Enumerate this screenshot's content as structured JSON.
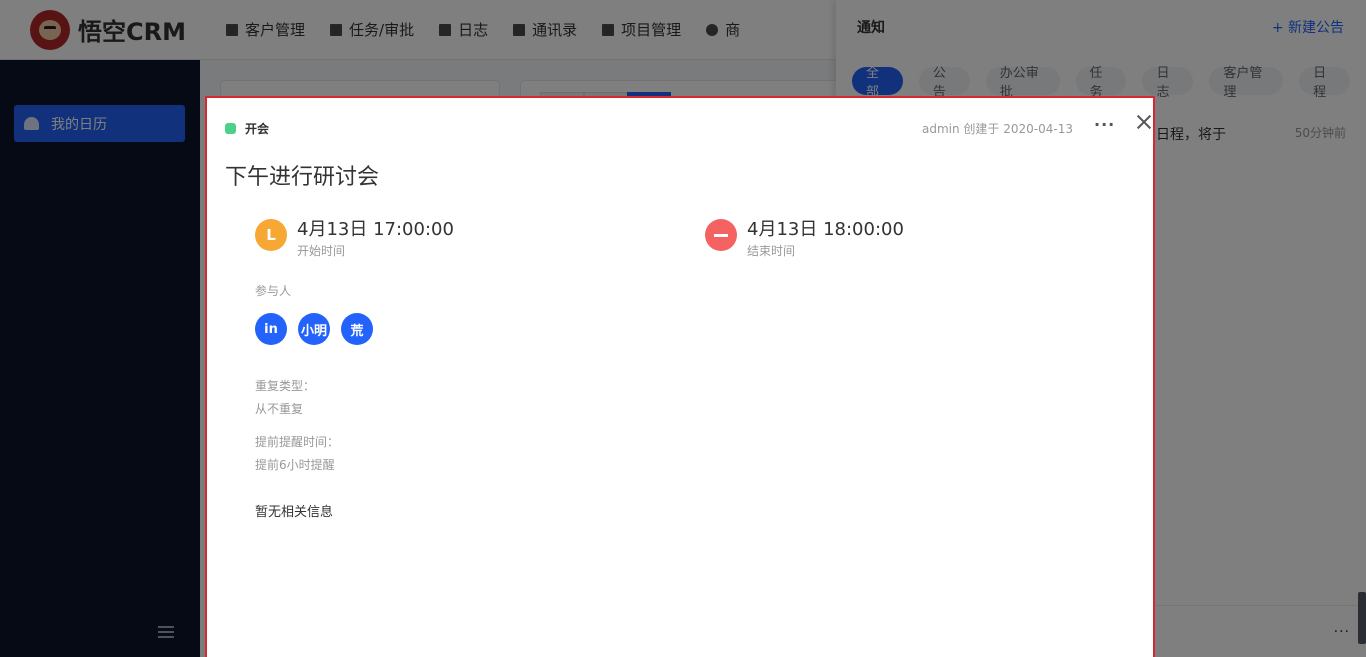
{
  "app": {
    "logo_text": "悟空CRM"
  },
  "nav": [
    "客户管理",
    "任务/审批",
    "日志",
    "通讯录",
    "项目管理",
    "商"
  ],
  "sidebar": {
    "active_item": "我的日历"
  },
  "notice_panel": {
    "title": "通知",
    "new_button": "+ 新建公告",
    "tabs": [
      "全部",
      "公告",
      "办公审批",
      "任务",
      "日志",
      "客户管理",
      "日程"
    ],
    "active_tab": 0,
    "item_text": "日程，将于",
    "item_time": "50分钟前",
    "footer_more": "···"
  },
  "dialog": {
    "type_label": "开会",
    "type_color": "#4cd08a",
    "creator_line": "admin 创建于 2020-04-13",
    "title": "下午进行研讨会",
    "start": {
      "icon_text": "L",
      "date": "4月13日 17:00:00",
      "label": "开始时间",
      "icon_color": "#f7a733"
    },
    "end": {
      "date": "4月13日 18:00:00",
      "label": "结束时间",
      "icon_color": "#f46262"
    },
    "participants_label": "参与人",
    "participants": [
      "in",
      "小明",
      "荒"
    ],
    "repeat_label": "重复类型：",
    "repeat_value": "从不重复",
    "remind_label": "提前提醒时间：",
    "remind_value": "提前6小时提醒",
    "no_info": "暂无相关信息",
    "border_color": "#d7282f",
    "accent_color": "#2362fb"
  }
}
